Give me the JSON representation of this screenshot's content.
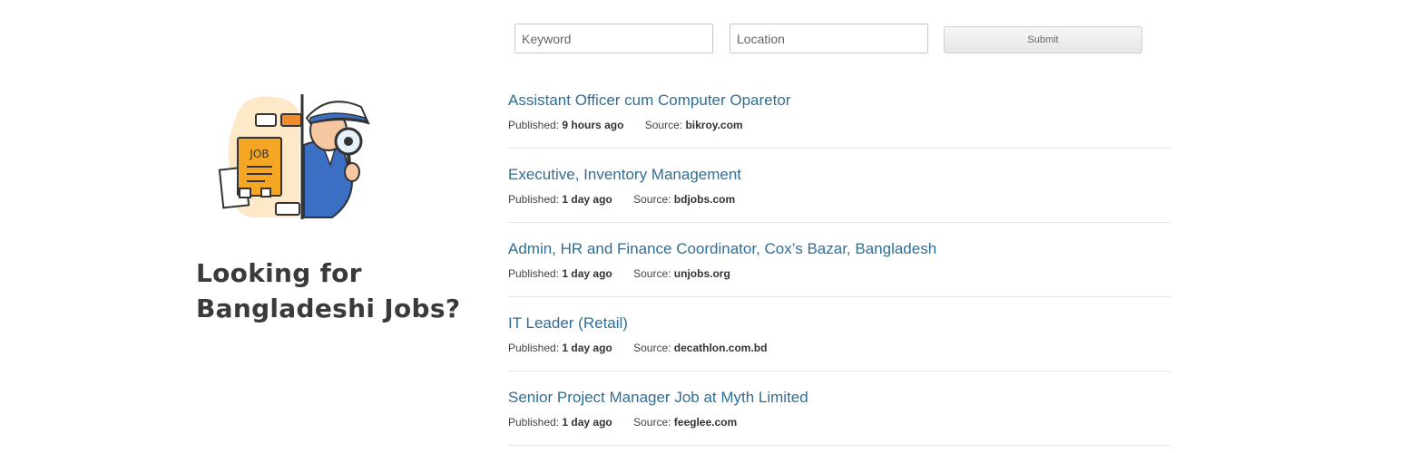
{
  "search": {
    "keyword_placeholder": "Keyword",
    "location_placeholder": "Location",
    "submit_label": "Submit"
  },
  "hero": {
    "illustration_icon": "detective-job-search-icon",
    "illustration_text": "JOB",
    "headline_line1": "Looking for",
    "headline_line2": "Bangladeshi Jobs?"
  },
  "jobs": [
    {
      "title": "Assistant Officer cum Computer Oparetor",
      "published_label": "Published:",
      "published": "9 hours ago",
      "source_label": "Source:",
      "source": "bikroy.com"
    },
    {
      "title": "Executive, Inventory Management",
      "published_label": "Published:",
      "published": "1 day ago",
      "source_label": "Source:",
      "source": "bdjobs.com"
    },
    {
      "title": "Admin, HR and Finance Coordinator, Cox’s Bazar, Bangladesh",
      "published_label": "Published:",
      "published": "1 day ago",
      "source_label": "Source:",
      "source": "unjobs.org"
    },
    {
      "title": "IT Leader (Retail)",
      "published_label": "Published:",
      "published": "1 day ago",
      "source_label": "Source:",
      "source": "decathlon.com.bd"
    },
    {
      "title": "Senior Project Manager Job at Myth Limited",
      "published_label": "Published:",
      "published": "1 day ago",
      "source_label": "Source:",
      "source": "feeglee.com"
    }
  ],
  "colors": {
    "link": "#2f6e96",
    "accent_orange": "#f5a623",
    "coat_blue": "#3a6fc4"
  }
}
